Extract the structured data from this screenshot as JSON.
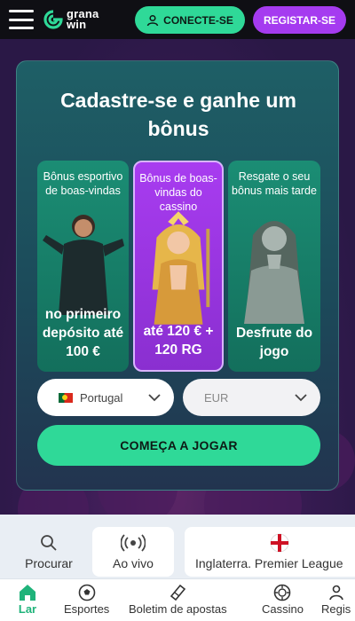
{
  "header": {
    "logo_line1": "grana",
    "logo_line2": "win",
    "connect_label": "CONECTE-SE",
    "register_label": "REGISTAR-SE"
  },
  "hero": {
    "title": "Cadastre-se e ganhe um bônus",
    "promos": [
      {
        "top": "Bônus esportivo de boas-vindas",
        "bottom": "no primeiro depósito até 100 €"
      },
      {
        "top": "Bônus de boas-vindas do cassino",
        "bottom": "até 120 € + 120 RG"
      },
      {
        "top": "Resgate o seu bônus mais tarde",
        "bottom": "Desfrute do jogo"
      }
    ],
    "country_value": "Portugal",
    "currency_placeholder": "EUR",
    "cta_label": "COMEÇA A JOGAR"
  },
  "quicknav": {
    "search_label": "Procurar",
    "live_label": "Ao vivo",
    "league_label": "Inglaterra. Premier League"
  },
  "bottomnav": {
    "items": [
      {
        "label": "Lar",
        "icon": "home-icon"
      },
      {
        "label": "Esportes",
        "icon": "soccer-ball-icon"
      },
      {
        "label": "Boletim de apostas",
        "icon": "ticket-icon"
      },
      {
        "label": "Cassino",
        "icon": "casino-chip-icon"
      },
      {
        "label": "Regis",
        "icon": "register-icon"
      }
    ]
  },
  "colors": {
    "accent_green": "#2fd998",
    "accent_purple": "#a53bf0",
    "header_bg": "#0f0f14",
    "active_nav": "#1fb37a"
  }
}
